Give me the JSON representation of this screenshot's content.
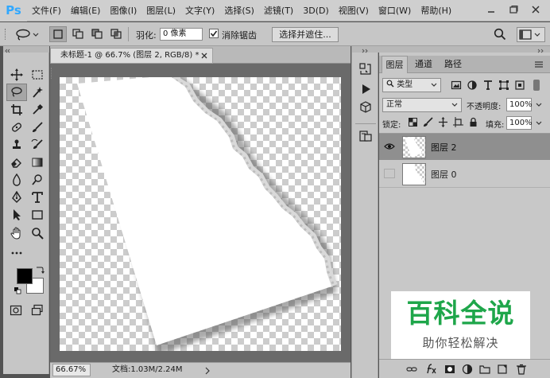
{
  "app": {
    "logo": "Ps"
  },
  "menu": [
    "文件(F)",
    "编辑(E)",
    "图像(I)",
    "图层(L)",
    "文字(Y)",
    "选择(S)",
    "滤镜(T)",
    "3D(D)",
    "视图(V)",
    "窗口(W)",
    "帮助(H)"
  ],
  "options": {
    "feather_label": "羽化:",
    "feather_value": "0 像素",
    "antialias_label": "消除锯齿",
    "select_mask_button": "选择并遮住..."
  },
  "document": {
    "tab_title": "未标题-1 @ 66.7% (图层 2, RGB/8) *",
    "zoom": "66.67%",
    "doc_size": "文档:1.03M/2.24M"
  },
  "layers_panel": {
    "tabs": [
      "图层",
      "通道",
      "路径"
    ],
    "filter_label": "类型",
    "blend_mode": "正常",
    "opacity_label": "不透明度:",
    "opacity_value": "100%",
    "lock_label": "锁定:",
    "fill_label": "填充:",
    "fill_value": "100%",
    "layers": [
      {
        "name": "图层 2",
        "visible": true,
        "selected": true
      },
      {
        "name": "图层 0",
        "visible": false,
        "selected": false
      }
    ]
  },
  "watermark": {
    "title": "百科全说",
    "subtitle": "助你轻松解决"
  },
  "colors": {
    "ui_bg": "#c6c6c6",
    "accent": "#31a8ff",
    "watermark_green": "#1ea64a"
  }
}
